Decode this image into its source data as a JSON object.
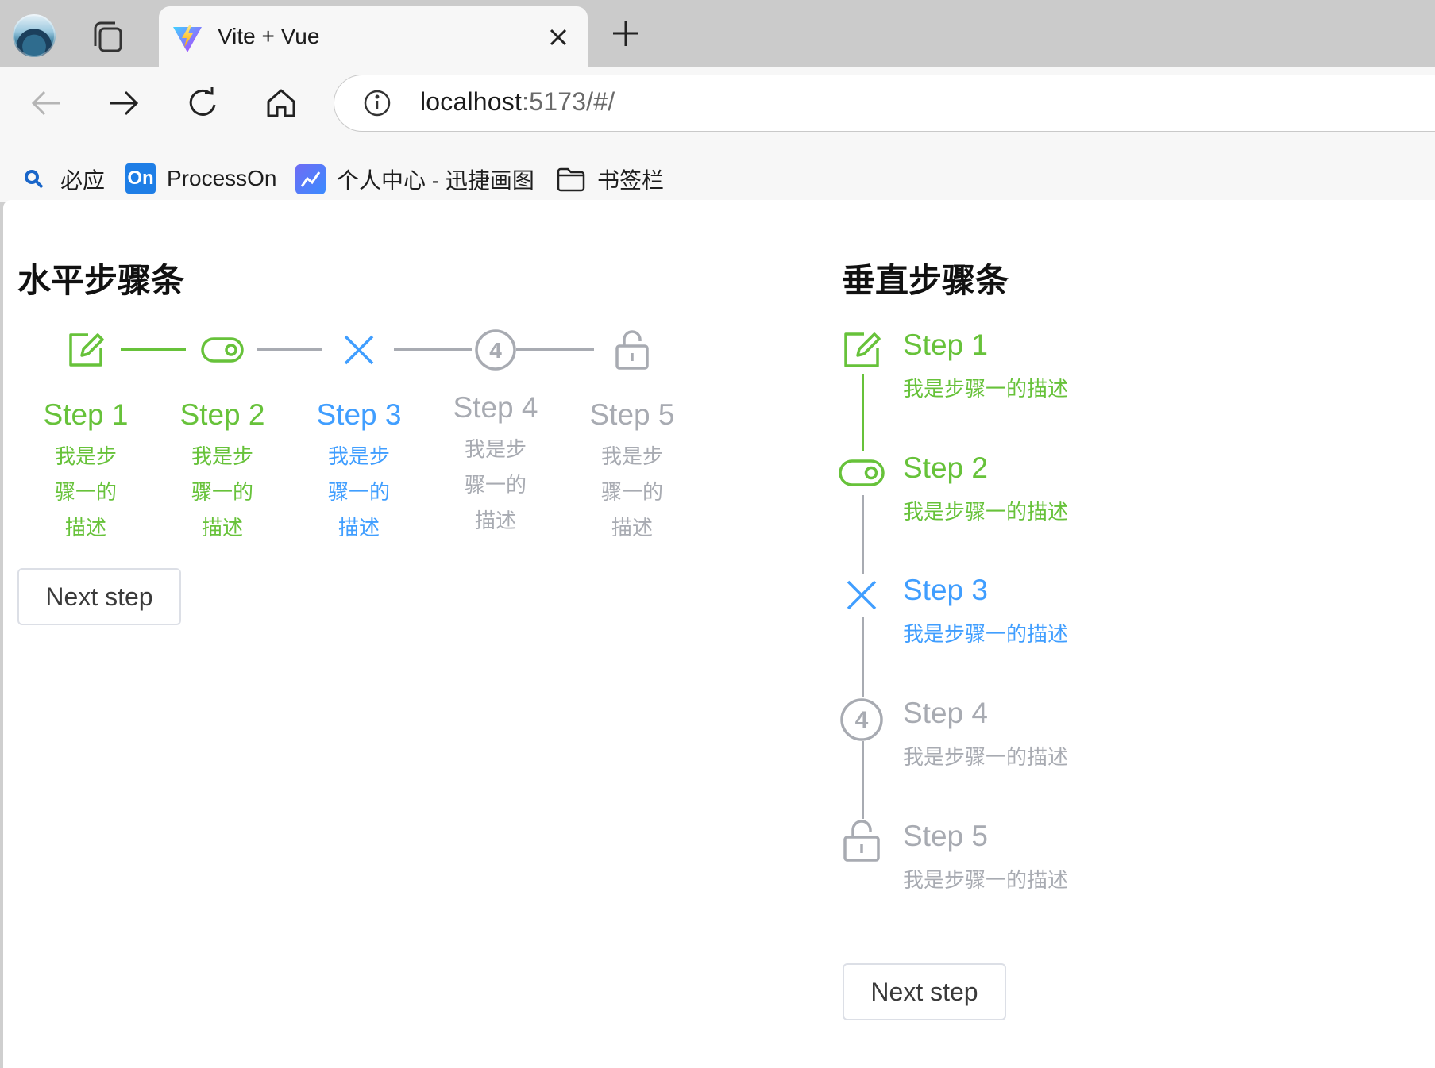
{
  "browser": {
    "tab": {
      "title": "Vite + Vue",
      "favicon": "vite-logo"
    },
    "address": {
      "host": "localhost",
      "rest": ":5173/#/"
    },
    "bookmarks": [
      {
        "label": "必应",
        "icon": "search-icon"
      },
      {
        "label": "ProcessOn",
        "icon": "processon-icon",
        "badge": "On"
      },
      {
        "label": "个人中心 - 迅捷画图",
        "icon": "chart-app-icon"
      },
      {
        "label": "书签栏",
        "icon": "folder-icon"
      }
    ]
  },
  "colors": {
    "finish": "#67c23a",
    "process": "#409eff",
    "wait": "#a8abb2"
  },
  "horizontal": {
    "title": "水平步骤条",
    "steps": [
      {
        "title": "Step 1",
        "desc": "我是步骤一的描述",
        "status": "finish",
        "icon": "edit-icon"
      },
      {
        "title": "Step 2",
        "desc": "我是步骤一的描述",
        "status": "finish",
        "icon": "toggle-icon"
      },
      {
        "title": "Step 3",
        "desc": "我是步骤一的描述",
        "status": "process",
        "icon": "close-icon"
      },
      {
        "title": "Step 4",
        "desc": "我是步骤一的描述",
        "status": "wait",
        "icon": "number-icon",
        "number": "4"
      },
      {
        "title": "Step 5",
        "desc": "我是步骤一的描述",
        "status": "wait",
        "icon": "unlock-icon"
      }
    ],
    "button": "Next step"
  },
  "vertical": {
    "title": "垂直步骤条",
    "steps": [
      {
        "title": "Step 1",
        "desc": "我是步骤一的描述",
        "status": "finish",
        "icon": "edit-icon"
      },
      {
        "title": "Step 2",
        "desc": "我是步骤一的描述",
        "status": "finish",
        "icon": "toggle-icon"
      },
      {
        "title": "Step 3",
        "desc": "我是步骤一的描述",
        "status": "process",
        "icon": "close-icon"
      },
      {
        "title": "Step 4",
        "desc": "我是步骤一的描述",
        "status": "wait",
        "icon": "number-icon",
        "number": "4"
      },
      {
        "title": "Step 5",
        "desc": "我是步骤一的描述",
        "status": "wait",
        "icon": "unlock-icon"
      }
    ],
    "button": "Next step"
  }
}
